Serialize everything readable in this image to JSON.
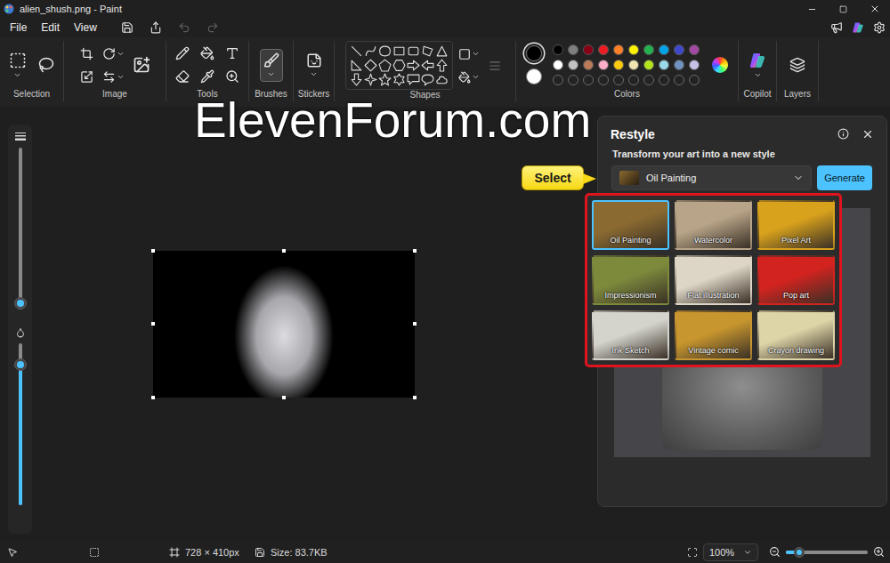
{
  "window": {
    "title": "alien_shush.png - Paint"
  },
  "menu_bar": {
    "menus": [
      "File",
      "Edit",
      "View"
    ],
    "quick_actions": [
      {
        "kind": "save",
        "disabled": false
      },
      {
        "kind": "share",
        "disabled": false
      },
      {
        "kind": "undo",
        "disabled": true
      },
      {
        "kind": "redo",
        "disabled": true
      }
    ]
  },
  "ribbon": {
    "groups": [
      {
        "label": "Selection",
        "kind": "selection",
        "selected": false
      },
      {
        "label": "Image",
        "kind": "image",
        "selected": false
      },
      {
        "label": "Tools",
        "kind": "tools",
        "selected": false
      },
      {
        "label": "Brushes",
        "kind": "brushes",
        "selected": true
      },
      {
        "label": "Stickers",
        "kind": "stickers",
        "selected": false
      },
      {
        "label": "Shapes",
        "kind": "shapes",
        "selected": false
      },
      {
        "label": "Colors",
        "kind": "colors",
        "selected": false
      },
      {
        "label": "Copilot",
        "kind": "copilot",
        "selected": false
      },
      {
        "label": "Layers",
        "kind": "layers",
        "selected": false
      }
    ]
  },
  "colors": {
    "primary": {
      "color": "#000000",
      "selected": true
    },
    "secondary": {
      "color": "#ffffff",
      "selected": false
    },
    "swatches": [
      {
        "kind": "filled",
        "color": "#000000"
      },
      {
        "kind": "filled",
        "color": "#7f7f7f"
      },
      {
        "kind": "filled",
        "color": "#880015"
      },
      {
        "kind": "filled",
        "color": "#ed1c24"
      },
      {
        "kind": "filled",
        "color": "#ff7f27"
      },
      {
        "kind": "filled",
        "color": "#fff200"
      },
      {
        "kind": "filled",
        "color": "#22b14c"
      },
      {
        "kind": "filled",
        "color": "#00a2e8"
      },
      {
        "kind": "filled",
        "color": "#3f48cc"
      },
      {
        "kind": "filled",
        "color": "#a349a4"
      },
      {
        "kind": "filled",
        "color": "#ffffff"
      },
      {
        "kind": "filled",
        "color": "#c3c3c3"
      },
      {
        "kind": "filled",
        "color": "#b97a57"
      },
      {
        "kind": "filled",
        "color": "#ffaec9"
      },
      {
        "kind": "filled",
        "color": "#ffc90e"
      },
      {
        "kind": "filled",
        "color": "#efe4b0"
      },
      {
        "kind": "filled",
        "color": "#b5e61d"
      },
      {
        "kind": "filled",
        "color": "#99d9ea"
      },
      {
        "kind": "filled",
        "color": "#7092be"
      },
      {
        "kind": "filled",
        "color": "#c8bfe7"
      },
      {
        "kind": "empty"
      },
      {
        "kind": "empty"
      },
      {
        "kind": "empty"
      },
      {
        "kind": "empty"
      },
      {
        "kind": "empty"
      },
      {
        "kind": "empty"
      },
      {
        "kind": "empty"
      },
      {
        "kind": "empty"
      },
      {
        "kind": "empty"
      },
      {
        "kind": "empty"
      }
    ]
  },
  "watermark": "ElevenForum.com",
  "left_sliders": [
    {
      "kind": "size",
      "level": 0.04
    },
    {
      "kind": "opacity",
      "level": 0.87
    }
  ],
  "restyle": {
    "title": "Restyle",
    "subtitle": "Transform your art into a new style",
    "dropdown": {
      "value": "Oil Painting",
      "expanded": true
    },
    "button": "Generate",
    "callout": "Select",
    "styles": [
      {
        "label": "Oil Painting",
        "selected": true,
        "color": "#8a6a30"
      },
      {
        "label": "Watercolor",
        "selected": false,
        "color": "#b8a488"
      },
      {
        "label": "Pixel Art",
        "selected": false,
        "color": "#d9a21c"
      },
      {
        "label": "Impressionism",
        "selected": false,
        "color": "#7d8a3c"
      },
      {
        "label": "Flat illustration",
        "selected": false,
        "color": "#ddd6c6"
      },
      {
        "label": "Pop art",
        "selected": false,
        "color": "#d3231f"
      },
      {
        "label": "Ink Sketch",
        "selected": false,
        "color": "#d4d4cc"
      },
      {
        "label": "Vintage comic",
        "selected": false,
        "color": "#c8962e"
      },
      {
        "label": "Crayon drawing",
        "selected": false,
        "color": "#ddd4a8"
      }
    ]
  },
  "status_bar": {
    "dimensions": "728 × 410px",
    "size": "Size: 83.7KB",
    "zoom": "100%",
    "zoom_level": 0.16
  }
}
